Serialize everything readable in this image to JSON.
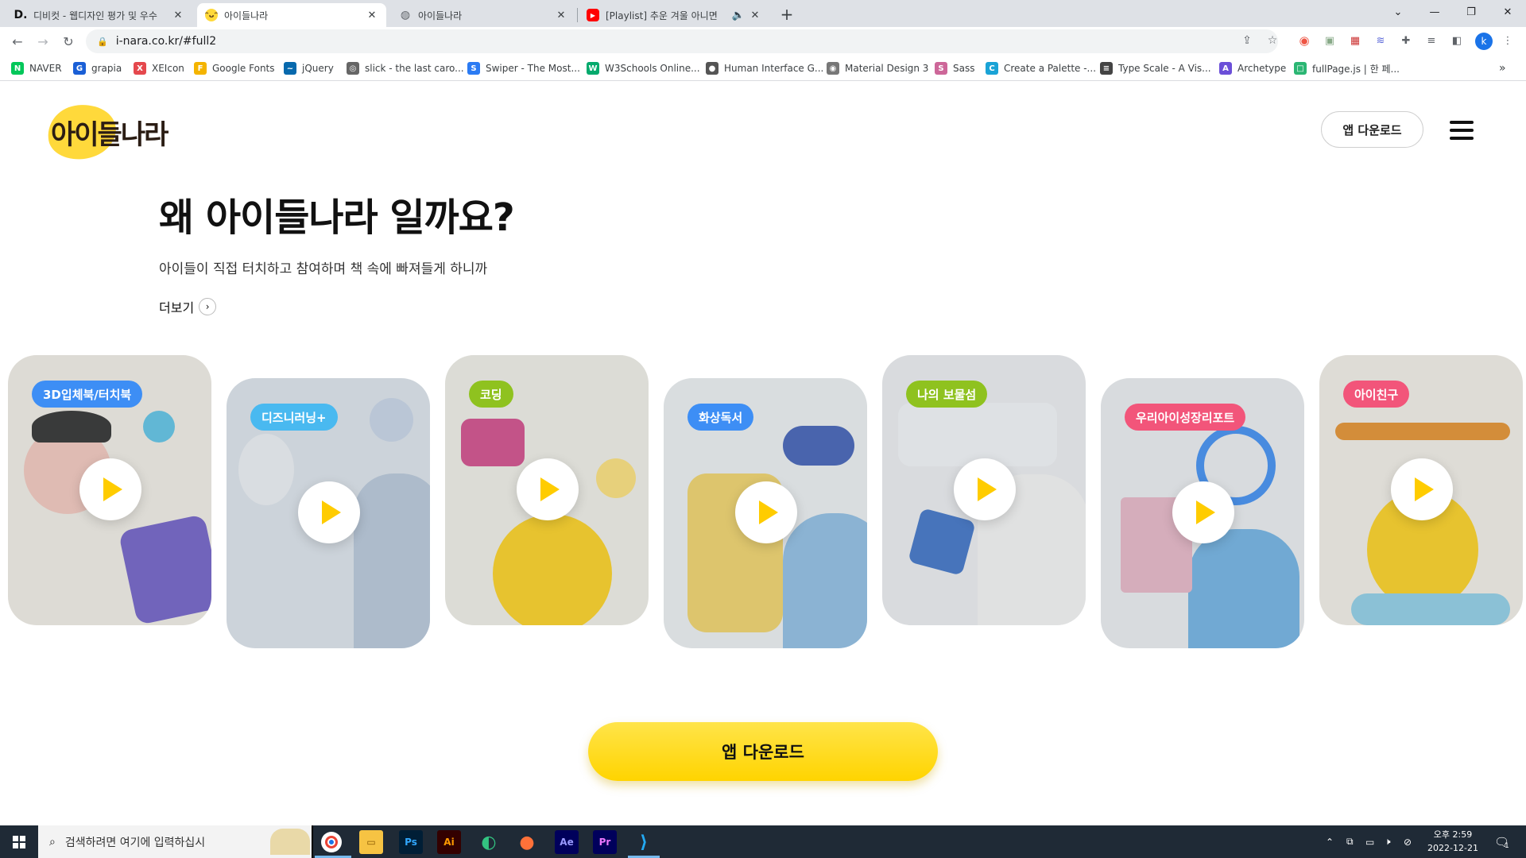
{
  "browser": {
    "tabs": [
      {
        "favicon": "D.",
        "title": "디비컷 - 웹디자인 평가 및 우수",
        "active": false
      },
      {
        "favicon": "smile-icon",
        "title": "아이들나라",
        "active": true
      },
      {
        "favicon": "globe-icon",
        "title": "아이들나라",
        "active": false
      },
      {
        "favicon": "youtube-icon",
        "title": "[Playlist] 추운 겨울 아니면",
        "active": false
      }
    ],
    "url": "i-nara.co.kr/#full2",
    "bookmarks": [
      {
        "label": "NAVER",
        "color": "#03c75a",
        "glyph": "N"
      },
      {
        "label": "grapia",
        "color": "#1a5fd6",
        "glyph": "G"
      },
      {
        "label": "XEIcon",
        "color": "#e5484d",
        "glyph": "X"
      },
      {
        "label": "Google Fonts",
        "color": "#f4b400",
        "glyph": "F"
      },
      {
        "label": "jQuery",
        "color": "#0769ad",
        "glyph": "~"
      },
      {
        "label": "slick - the last caro...",
        "color": "#666666",
        "glyph": "◎"
      },
      {
        "label": "Swiper - The Most...",
        "color": "#2b7bf3",
        "glyph": "S"
      },
      {
        "label": "W3Schools Online...",
        "color": "#04aa6d",
        "glyph": "W"
      },
      {
        "label": "Human Interface G...",
        "color": "#555555",
        "glyph": ""
      },
      {
        "label": "Material Design 3",
        "color": "#777777",
        "glyph": "◉"
      },
      {
        "label": "Sass",
        "color": "#cd6799",
        "glyph": "S"
      },
      {
        "label": "Create a Palette -...",
        "color": "#1aa3d6",
        "glyph": "C"
      },
      {
        "label": "Type Scale - A Vis...",
        "color": "#444444",
        "glyph": "≡"
      },
      {
        "label": "Archetype",
        "color": "#6b4fd8",
        "glyph": "A"
      },
      {
        "label": "fullPage.js | 한 페...",
        "color": "#2bb673",
        "glyph": "□"
      }
    ],
    "profile_initial": "k"
  },
  "header": {
    "logo_text": "아이들나라",
    "app_download_label": "앱 다운로드"
  },
  "hero": {
    "title": "왜 아이들나라 일까요?",
    "subtitle": "아이들이 직접 터치하고 참여하며 책 속에 빠져들게 하니까",
    "more_label": "더보기"
  },
  "cards": [
    {
      "tag": "3D입체북/터치북",
      "tag_color": "#3d8ef5",
      "bg": "#f3efe8"
    },
    {
      "tag": "디즈니러닝+",
      "tag_color": "#49b9f0",
      "bg": "#dfe6ee"
    },
    {
      "tag": "코딩",
      "tag_color": "#8fc21f",
      "bg": "#f2f1ea"
    },
    {
      "tag": "화상독서",
      "tag_color": "#3d8ef5",
      "bg": "#eef2f5"
    },
    {
      "tag": "나의 보물섬",
      "tag_color": "#8fc21f",
      "bg": "#eef0f3"
    },
    {
      "tag": "우리아이성장리포트",
      "tag_color": "#f2557a",
      "bg": "#edf0f3"
    },
    {
      "tag": "아이친구",
      "tag_color": "#f2557a",
      "bg": "#f5f1ea"
    }
  ],
  "cta": {
    "label": "앱 다운로드"
  },
  "taskbar": {
    "search_placeholder": "검색하려면 여기에 입력하십시",
    "time": "오후 2:59",
    "date": "2022-12-21",
    "notification_count": "1"
  }
}
